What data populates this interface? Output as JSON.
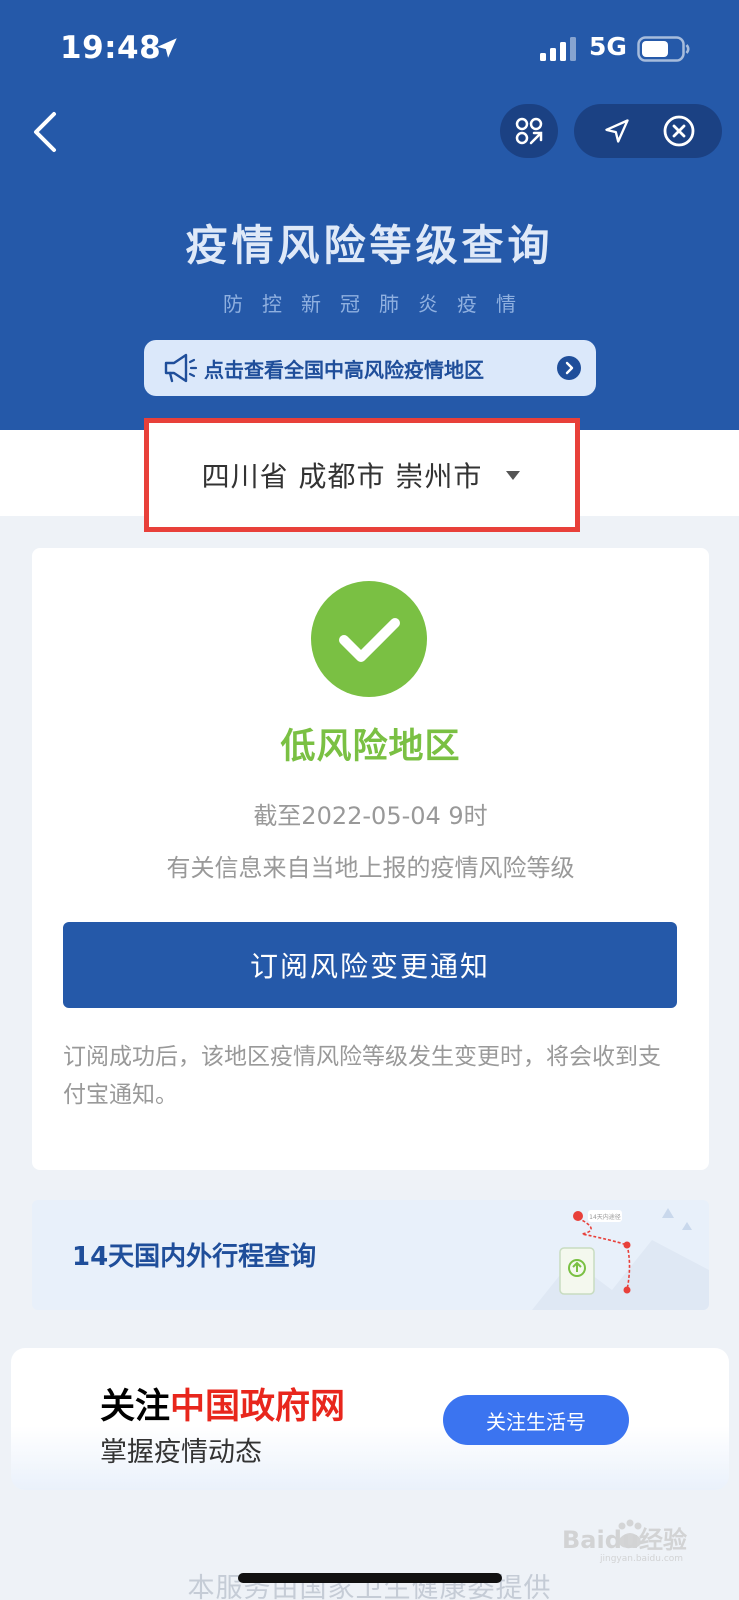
{
  "status_bar": {
    "time": "19:48",
    "network": "5G"
  },
  "header": {
    "title": "疫情风险等级查询",
    "subtitle": "防控新冠肺炎疫情",
    "banner_text": "点击查看全国中高风险疫情地区"
  },
  "location": {
    "text": "四川省 成都市 崇州市"
  },
  "result": {
    "risk_level": "低风险地区",
    "as_of": "截至2022-05-04 9时",
    "source_note": "有关信息来自当地上报的疫情风险等级",
    "subscribe_label": "订阅风险变更通知",
    "subscribe_note": "订阅成功后，该地区疫情风险等级发生变更时，将会收到支付宝通知。"
  },
  "trip_query": {
    "title": "14天国内外行程查询",
    "map_badge": "14天内途径"
  },
  "follow": {
    "prefix": "关注",
    "highlight": "中国政府网",
    "line2": "掌握疫情动态",
    "button_label": "关注生活号"
  },
  "footer": {
    "text": "本服务由国家卫生健康委提供"
  },
  "watermark": {
    "text": "Baidu经验",
    "subtext": "jingyan.baidu.com"
  },
  "colors": {
    "header_bg": "#2559a9",
    "accent_green": "#7ac043",
    "highlight_red": "#e8261c",
    "follow_button": "#3b74f0",
    "frame_red": "#e8403a"
  },
  "icons": {
    "back": "chevron-left-icon",
    "scan": "scan-icon",
    "locate": "navigation-arrow-icon",
    "close": "close-circle-icon",
    "banner": "megaphone-icon",
    "banner_arrow": "chevron-right-circle-icon",
    "caret": "caret-down-icon",
    "result": "check-circle-icon"
  }
}
